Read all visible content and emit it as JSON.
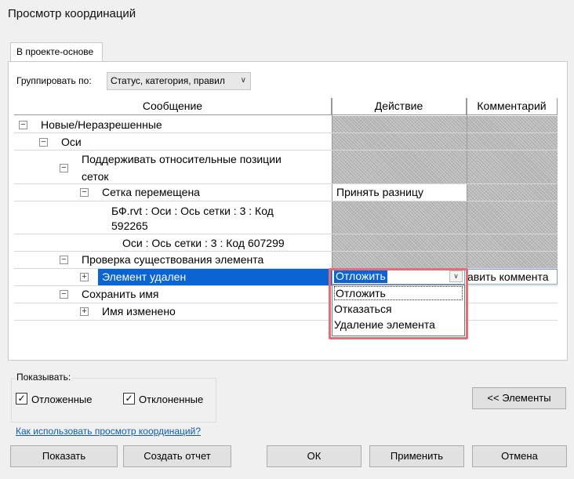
{
  "window": {
    "title": "Просмотр координаций"
  },
  "tabs": [
    {
      "label": "В проекте-основе"
    }
  ],
  "group_by": {
    "label": "Группировать по:",
    "value": "Статус, категория, правил"
  },
  "grid": {
    "columns": [
      "Сообщение",
      "Действие",
      "Комментарий"
    ],
    "rows": {
      "new_unresolved": "Новые/Неразрешенные",
      "axes": "Оси",
      "keep_relative_line1": "Поддерживать относительные позиции",
      "keep_relative_line2": "сеток",
      "grid_moved": "Сетка перемещена",
      "grid_moved_action": "Принять разницу",
      "bf_line1": "БФ.rvt : Оси : Ось сетки : 3 : Код",
      "bf_line2": "592265",
      "axes_code": "Оси : Ось сетки : 3 : Код 607299",
      "check_exists": "Проверка существования элемента",
      "element_removed": "Элемент удален",
      "element_removed_action": "Отложить",
      "element_removed_comment": "авить коммента",
      "keep_name": "Сохранить имя",
      "name_changed": "Имя изменено"
    },
    "dropdown_options": [
      "Отложить",
      "Отказаться",
      "Удаление элемента"
    ]
  },
  "show": {
    "label": "Показывать:",
    "postponed": {
      "label": "Отложенные",
      "checked": true
    },
    "rejected": {
      "label": "Отклоненные",
      "checked": true
    }
  },
  "elements_button": "<< Элементы",
  "help_link": "Как использовать просмотр координаций?",
  "buttons": {
    "show": "Показать",
    "create_report": "Создать отчет",
    "ok": "ОК",
    "apply": "Применить",
    "cancel": "Отмена"
  },
  "colors": {
    "selection": "#0a64d2",
    "highlight_border": "#e07078",
    "link": "#0f5bbd"
  },
  "icons": [
    "collapse-icon",
    "expand-icon",
    "chevron-down-icon",
    "checkmark-icon"
  ]
}
